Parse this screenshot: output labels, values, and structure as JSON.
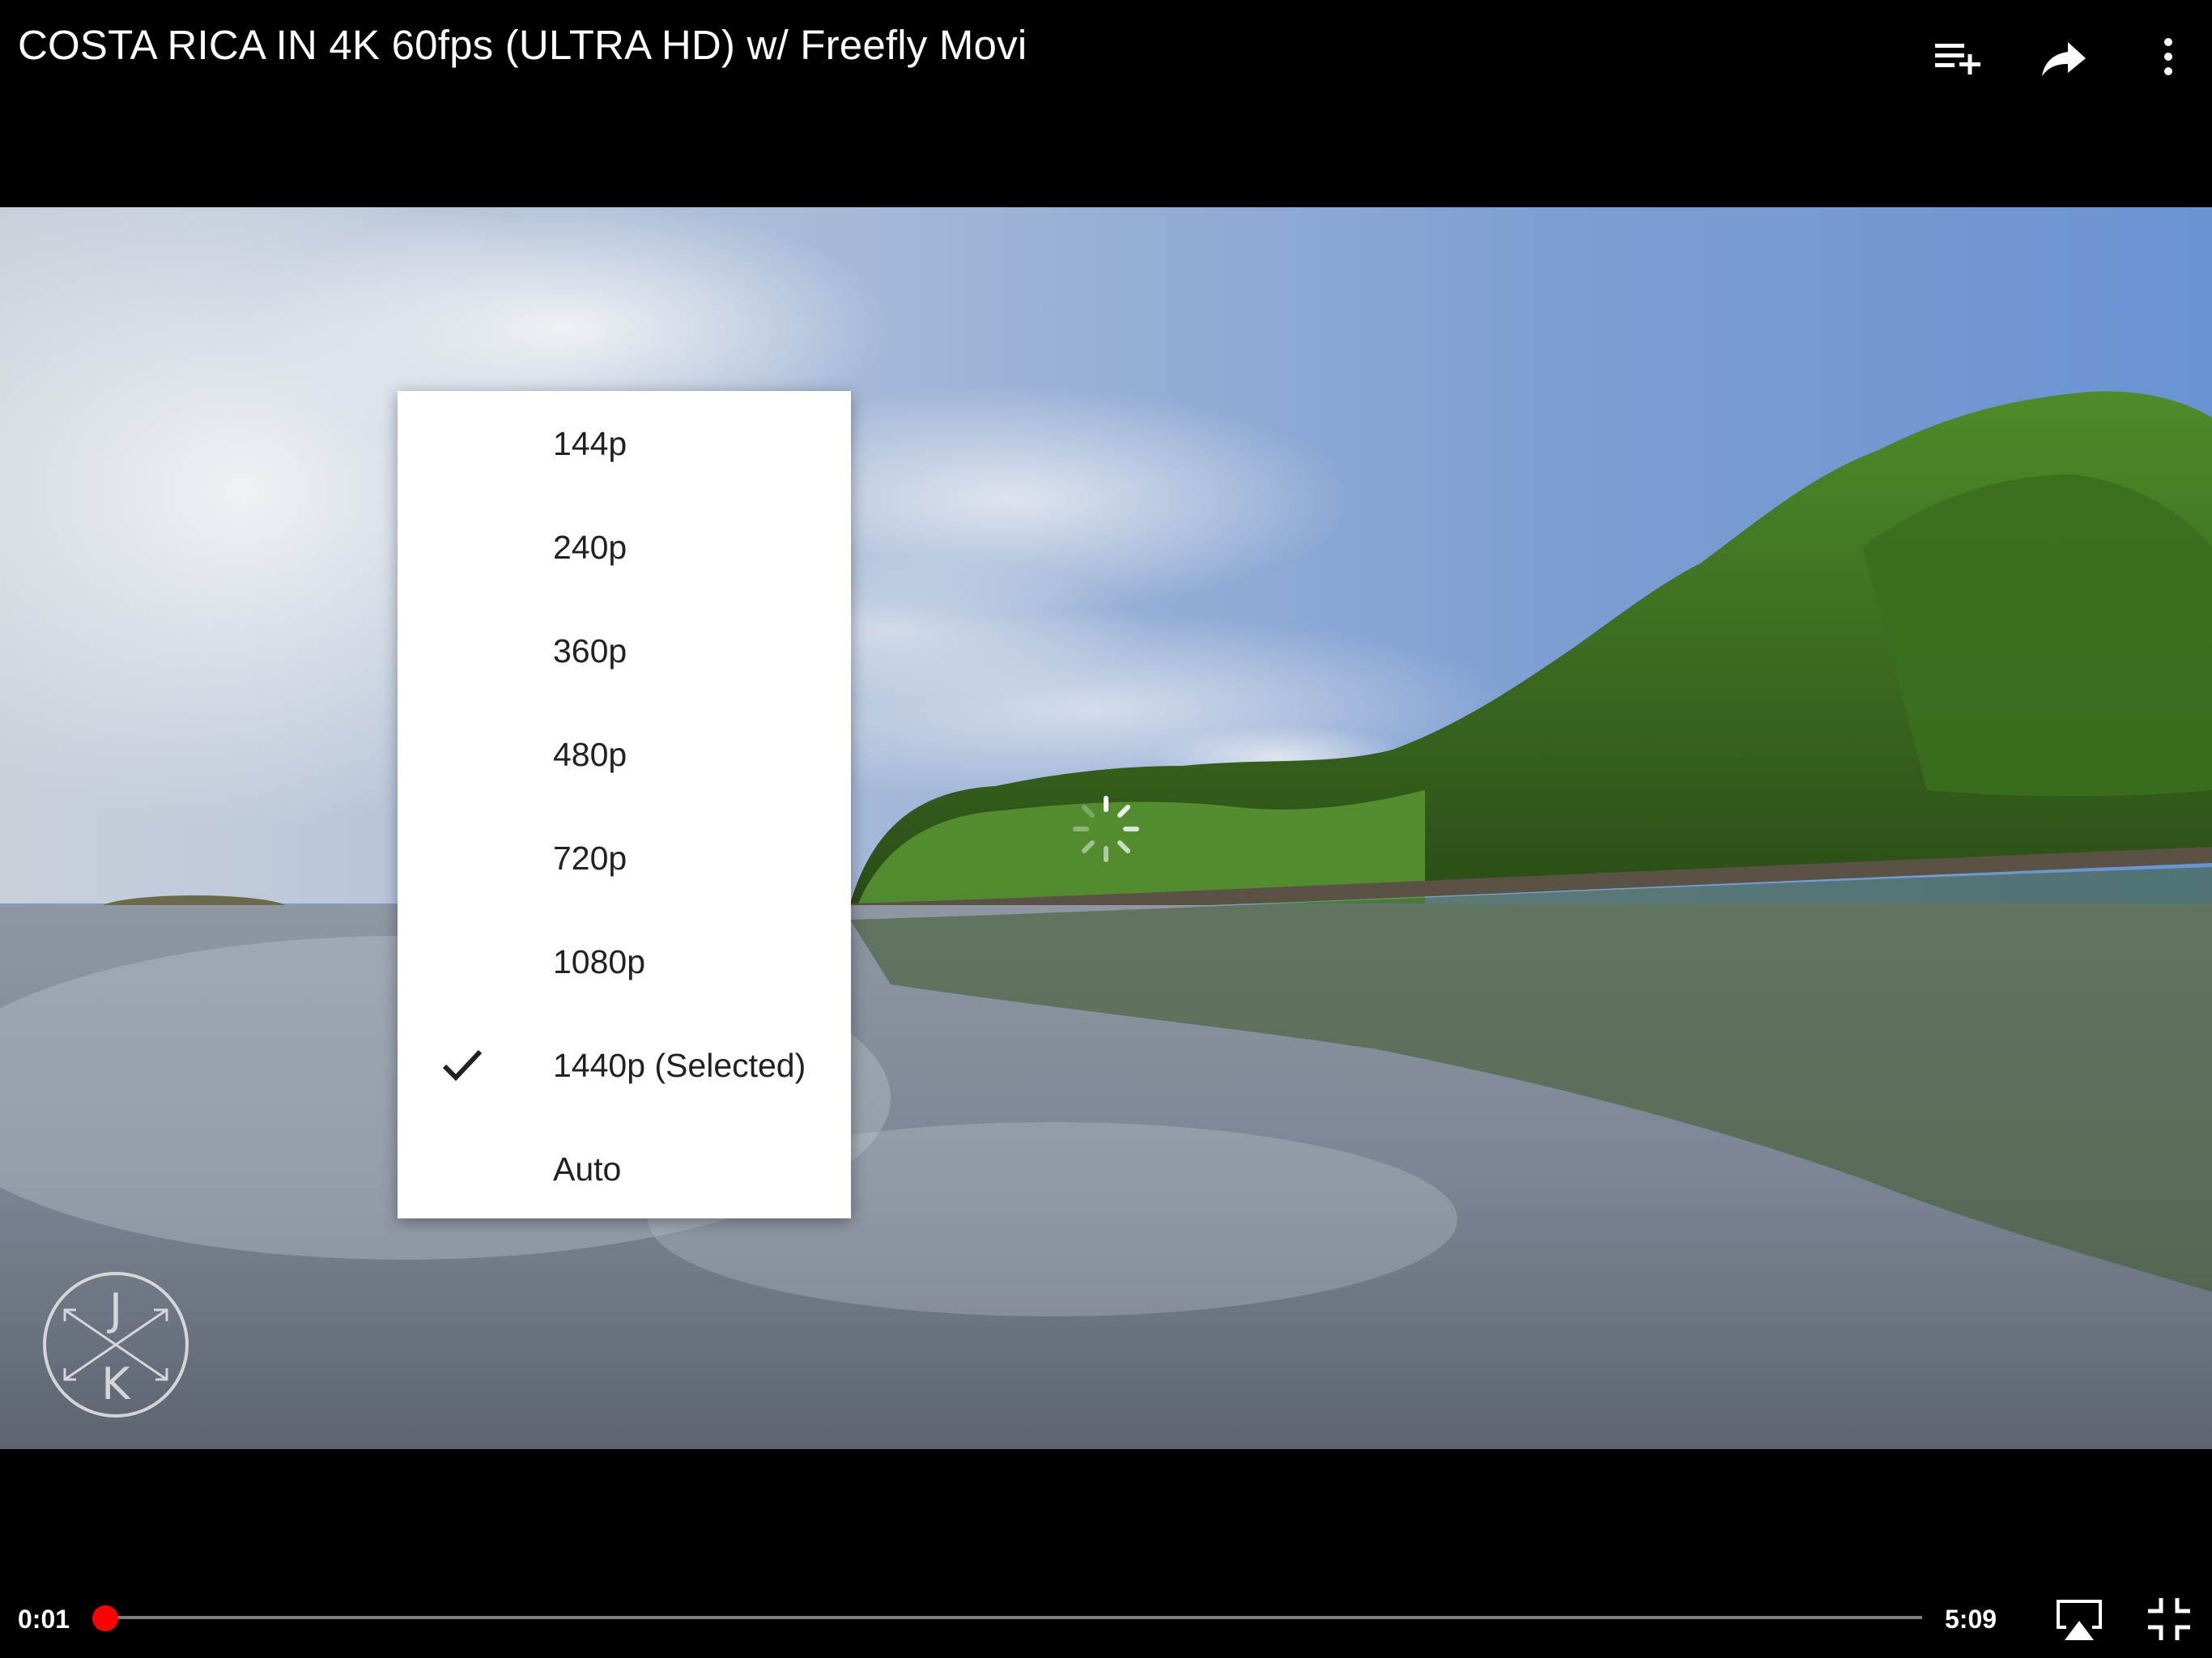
{
  "video": {
    "title": "COSTA RICA IN 4K 60fps (ULTRA HD) w/ Freefly Movi",
    "watermark_letters": [
      "J",
      "K"
    ]
  },
  "top_actions": [
    {
      "name": "add-to-playlist-icon",
      "label": "Add to playlist"
    },
    {
      "name": "share-icon",
      "label": "Share"
    },
    {
      "name": "more-options-icon",
      "label": "More options"
    }
  ],
  "quality_menu": {
    "items": [
      {
        "label": "144p",
        "selected": false
      },
      {
        "label": "240p",
        "selected": false
      },
      {
        "label": "360p",
        "selected": false
      },
      {
        "label": "480p",
        "selected": false
      },
      {
        "label": "720p",
        "selected": false
      },
      {
        "label": "1080p",
        "selected": false
      },
      {
        "label": "1440p (Selected)",
        "selected": true
      },
      {
        "label": "Auto",
        "selected": false
      }
    ]
  },
  "playback": {
    "current_time": "0:01",
    "duration": "5:09",
    "progress_fraction": 0.003,
    "accent_color": "#ff0000"
  },
  "bottom_actions": [
    {
      "name": "airplay-icon"
    },
    {
      "name": "exit-fullscreen-icon"
    }
  ]
}
